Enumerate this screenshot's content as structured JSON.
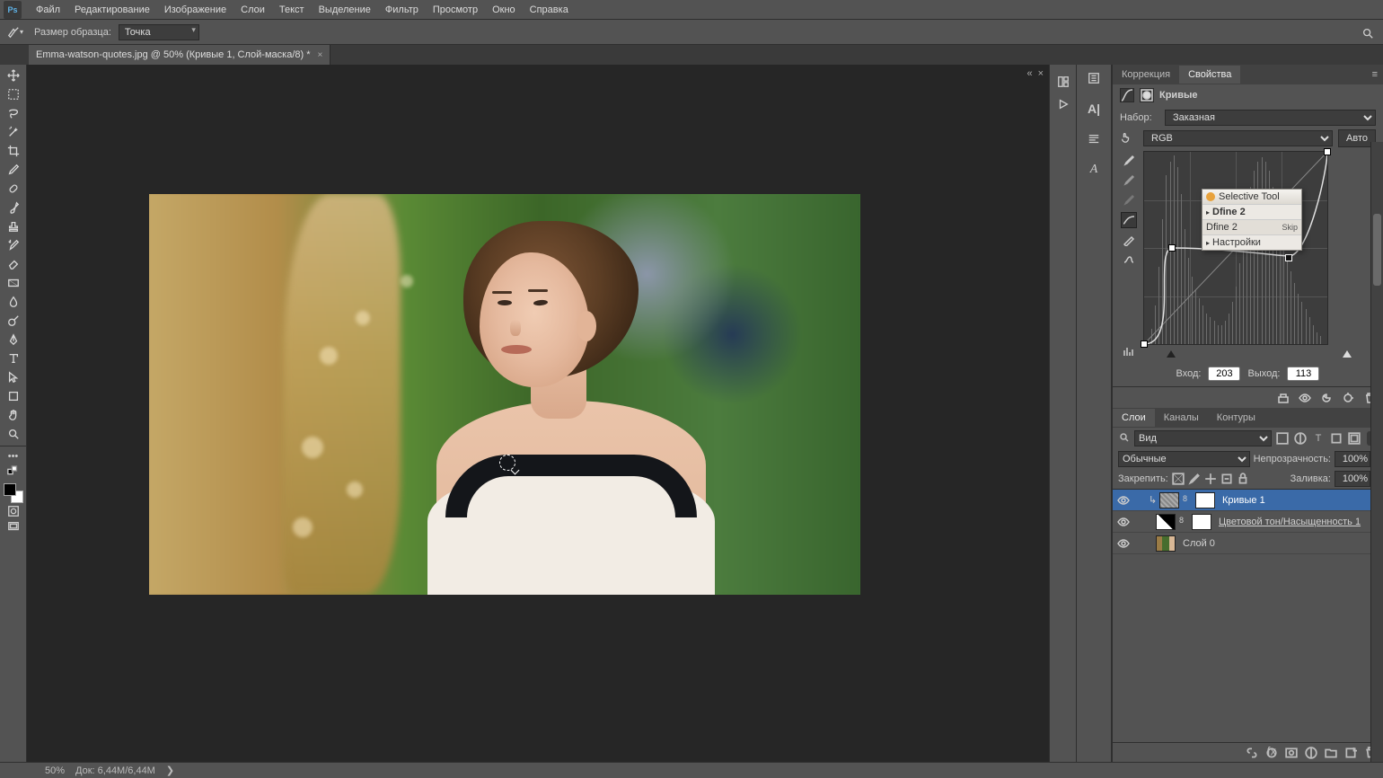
{
  "menu": {
    "items": [
      "Файл",
      "Редактирование",
      "Изображение",
      "Слои",
      "Текст",
      "Выделение",
      "Фильтр",
      "Просмотр",
      "Окно",
      "Справка"
    ]
  },
  "options": {
    "sample_label": "Размер образца:",
    "sample_value": "Точка"
  },
  "tab": {
    "title": "Emma-watson-quotes.jpg @ 50% (Кривые 1, Слой-маска/8) *"
  },
  "panels": {
    "correction_tab": "Коррекция",
    "properties_tab": "Свойства",
    "prop_title": "Кривые",
    "preset_label": "Набор:",
    "preset_value": "Заказная",
    "channel_value": "RGB",
    "auto_button": "Авто",
    "input_label": "Вход:",
    "input_value": "203",
    "output_label": "Выход:",
    "output_value": "113"
  },
  "float": {
    "title": "Selective Tool",
    "body": "Dfine 2",
    "sub": "Dfine 2",
    "skip": "Skip",
    "settings": "Настройки"
  },
  "layers": {
    "tab_layers": "Слои",
    "tab_channels": "Каналы",
    "tab_paths": "Контуры",
    "filter_label": "Вид",
    "blend_mode": "Обычные",
    "opacity_label": "Непрозрачность:",
    "opacity_value": "100%",
    "lock_label": "Закрепить:",
    "fill_label": "Заливка:",
    "fill_value": "100%",
    "items": [
      {
        "name": "Кривые 1"
      },
      {
        "name": "Цветовой тон/Насыщенность 1"
      },
      {
        "name": "Слой 0"
      }
    ]
  },
  "status": {
    "zoom": "50%",
    "doc": "Док: 6,44M/6,44M"
  }
}
